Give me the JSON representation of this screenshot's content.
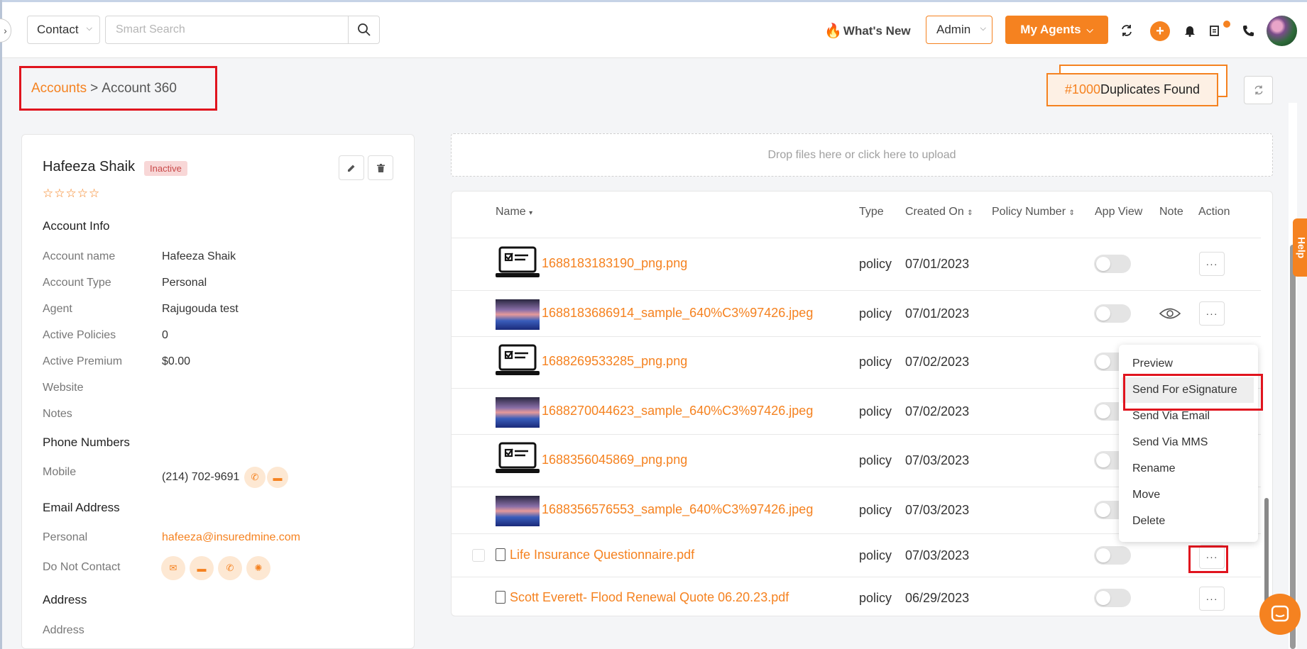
{
  "header": {
    "contact_select": "Contact",
    "search_placeholder": "Smart Search",
    "whats_new": "What's New",
    "admin_select": "Admin",
    "my_agents": "My Agents"
  },
  "breadcrumb": {
    "parent": "Accounts",
    "separator": ">",
    "current": "Account 360"
  },
  "duplicates": {
    "count": "#1000",
    "label": "Duplicates Found"
  },
  "account": {
    "name": "Hafeeza Shaik",
    "status": "Inactive",
    "stars": "☆☆☆☆☆",
    "sections": {
      "account_info": "Account Info",
      "phone_numbers": "Phone Numbers",
      "email_address": "Email Address",
      "address": "Address"
    },
    "fields": {
      "account_name": {
        "label": "Account name",
        "value": "Hafeeza Shaik"
      },
      "account_type": {
        "label": "Account Type",
        "value": "Personal"
      },
      "agent": {
        "label": "Agent",
        "value": "Rajugouda test"
      },
      "active_policies": {
        "label": "Active Policies",
        "value": "0"
      },
      "active_premium": {
        "label": "Active Premium",
        "value": "$0.00"
      },
      "website": {
        "label": "Website",
        "value": ""
      },
      "notes": {
        "label": "Notes",
        "value": ""
      },
      "mobile": {
        "label": "Mobile",
        "value": "(214) 702-9691"
      },
      "personal_email": {
        "label": "Personal",
        "value": "hafeeza@insuredmine.com"
      },
      "do_not_contact": {
        "label": "Do Not Contact"
      },
      "address": {
        "label": "Address"
      }
    }
  },
  "files": {
    "dropzone": "Drop files here or click here to upload",
    "columns": {
      "name": "Name",
      "type": "Type",
      "created_on": "Created On",
      "policy_number": "Policy Number",
      "app_view": "App View",
      "note": "Note",
      "action": "Action"
    },
    "rows": [
      {
        "name": "1688183183190_png.png",
        "type": "policy",
        "created": "07/01/2023"
      },
      {
        "name": "1688183686914_sample_640%C3%97426.jpeg",
        "type": "policy",
        "created": "07/01/2023"
      },
      {
        "name": "1688269533285_png.png",
        "type": "policy",
        "created": "07/02/2023"
      },
      {
        "name": "1688270044623_sample_640%C3%97426.jpeg",
        "type": "policy",
        "created": "07/02/2023"
      },
      {
        "name": "1688356045869_png.png",
        "type": "policy",
        "created": "07/03/2023"
      },
      {
        "name": "1688356576553_sample_640%C3%97426.jpeg",
        "type": "policy",
        "created": "07/03/2023"
      },
      {
        "name": "Life Insurance Questionnaire.pdf",
        "type": "policy",
        "created": "07/03/2023"
      },
      {
        "name": "Scott Everett- Flood Renewal Quote 06.20.23.pdf",
        "type": "policy",
        "created": "06/29/2023"
      }
    ]
  },
  "action_menu": {
    "items": [
      "Preview",
      "Send For eSignature",
      "Send Via Email",
      "Send Via MMS",
      "Rename",
      "Move",
      "Delete"
    ]
  },
  "help_tab": "Help",
  "colors": {
    "accent": "#f58220",
    "highlight_box": "#e0141e"
  }
}
